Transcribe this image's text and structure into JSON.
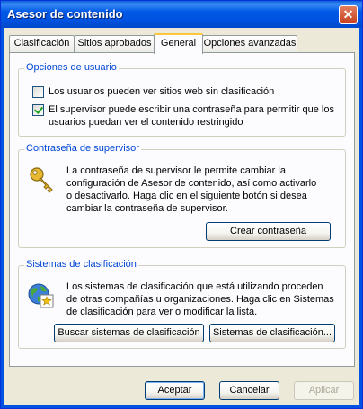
{
  "window": {
    "title": "Asesor de contenido",
    "close_glyph": "✕"
  },
  "tabs": [
    {
      "label": "Clasificación",
      "active": false
    },
    {
      "label": "Sitios aprobados",
      "active": false
    },
    {
      "label": "General",
      "active": true
    },
    {
      "label": "Opciones avanzadas",
      "active": false
    }
  ],
  "user_options": {
    "legend": "Opciones de usuario",
    "option1": {
      "label": "Los usuarios pueden ver sitios web sin clasificación",
      "checked": false
    },
    "option2": {
      "line1": "El supervisor puede escribir una contraseña para permitir que los",
      "line2": "usuarios puedan ver el contenido restringido",
      "checked": true
    }
  },
  "supervisor_password": {
    "legend": "Contraseña de supervisor",
    "icon": "key-icon",
    "line1": "La contraseña de supervisor le permite cambiar la",
    "line2": "configuración de Asesor de contenido, así como activarlo",
    "line3": "o desactivarlo. Haga clic en el siguiente botón si desea",
    "line4": "cambiar la contraseña de supervisor.",
    "button": "Crear contraseña"
  },
  "rating_systems": {
    "legend": "Sistemas de clasificación",
    "icon": "globe-certificate-icon",
    "line1": "Los sistemas de clasificación que está utilizando proceden",
    "line2": "de otras compañías u organizaciones. Haga clic en Sistemas",
    "line3": "de clasificación para ver o modificar la lista.",
    "find_button": "Buscar sistemas de clasificación",
    "systems_button": "Sistemas de clasificación..."
  },
  "footer": {
    "ok": "Aceptar",
    "cancel": "Cancelar",
    "apply": "Aplicar"
  },
  "colors": {
    "titlebar": "#0053e1",
    "accent_tab": "#ffc83c",
    "legend_text": "#0046d5",
    "dialog_bg": "#ece9d8"
  }
}
